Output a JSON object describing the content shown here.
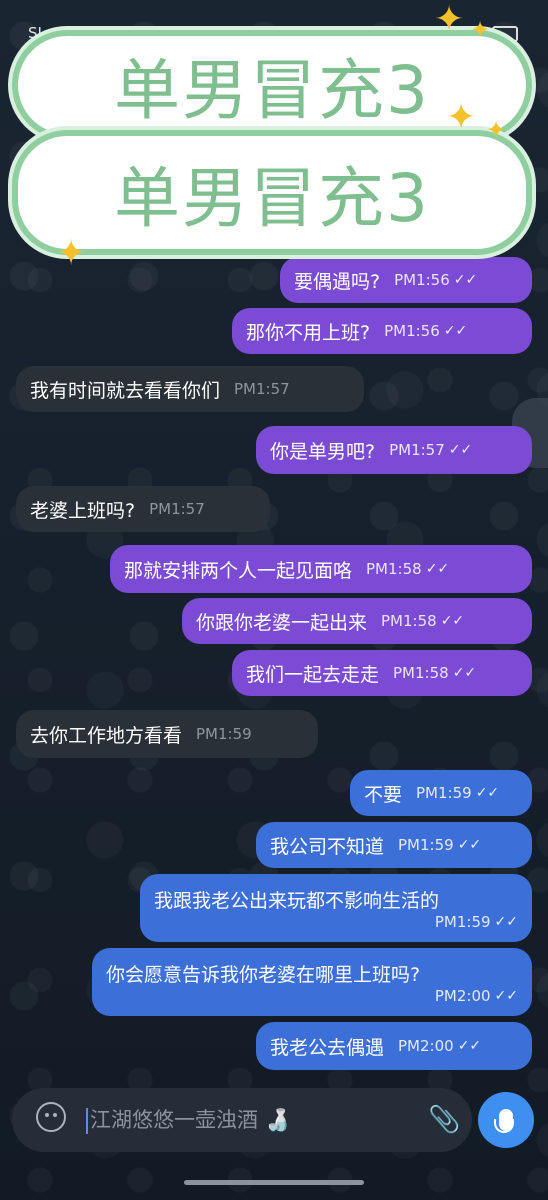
{
  "status": {
    "carrier": "SI"
  },
  "banner": {
    "text1": "单男冒充3",
    "text2": "单男冒充3"
  },
  "messages": [
    {
      "text": "要偶遇吗?",
      "time": "PM1:56",
      "ticks": "✓✓"
    },
    {
      "text": "那你不用上班?",
      "time": "PM1:56",
      "ticks": "✓✓"
    },
    {
      "text": "我有时间就去看看你们",
      "time": "PM1:57"
    },
    {
      "text": "你是单男吧?",
      "time": "PM1:57",
      "ticks": "✓✓"
    },
    {
      "text": "老婆上班吗?",
      "time": "PM1:57"
    },
    {
      "text": "那就安排两个人一起见面咯",
      "time": "PM1:58",
      "ticks": "✓✓"
    },
    {
      "text": "你跟你老婆一起出来",
      "time": "PM1:58",
      "ticks": "✓✓"
    },
    {
      "text": "我们一起去走走",
      "time": "PM1:58",
      "ticks": "✓✓"
    },
    {
      "text": "去你工作地方看看",
      "time": "PM1:59"
    },
    {
      "text": "不要",
      "time": "PM1:59",
      "ticks": "✓✓"
    },
    {
      "text": "我公司不知道",
      "time": "PM1:59",
      "ticks": "✓✓"
    },
    {
      "text": "我跟我老公出来玩都不影响生活的",
      "time": "PM1:59",
      "ticks": "✓✓"
    },
    {
      "text": "你会愿意告诉我你老婆在哪里上班吗?",
      "time": "PM2:00",
      "ticks": "✓✓"
    },
    {
      "text": "我老公去偶遇",
      "time": "PM2:00",
      "ticks": "✓✓"
    }
  ],
  "input": {
    "placeholder": "江湖悠悠一壶浊酒",
    "emoji": "🍶"
  },
  "colors": {
    "outgoing": "#7b4bd6",
    "outgoing_blue": "#3d6fd8",
    "incoming": "#2a3038",
    "mic": "#3e8ff0"
  },
  "icons": [
    "emoji-icon",
    "attach-icon",
    "mic-icon"
  ]
}
